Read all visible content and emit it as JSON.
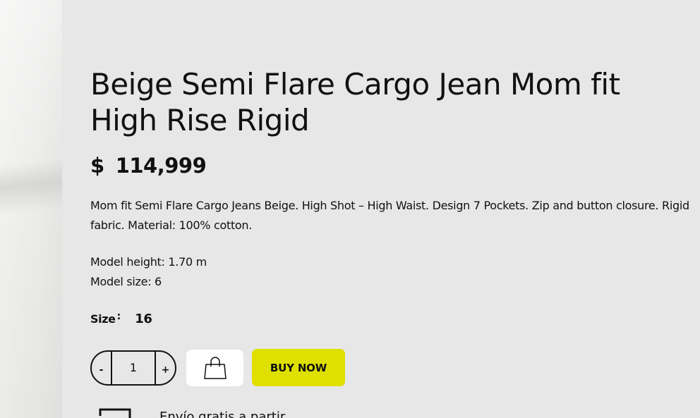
{
  "product": {
    "title": "Beige Semi Flare Cargo Jean Mom fit High Rise Rigid",
    "price": {
      "currency": "$",
      "amount": "114,999"
    },
    "description": "Mom fit Semi Flare Cargo Jeans Beige. High Shot – High Waist. Design 7 Pockets. Zip and button closure. Rigid fabric. Material: 100% cotton.",
    "model_height": "Model height: 1.70 m",
    "model_size": "Model size: 6"
  },
  "size": {
    "label": "Size",
    "colon": ":",
    "value": "16"
  },
  "quantity": {
    "decrement_label": "-",
    "increment_label": "+",
    "value": "1"
  },
  "buttons": {
    "add_to_cart_icon": "shopping-bag-icon",
    "buy_now_label": "BUY NOW"
  },
  "shipping": {
    "icon": "truck-icon",
    "text": "Envío gratis a partir"
  },
  "colors": {
    "page_background": "#e7e7e7",
    "buy_now": "#dfe000",
    "cart_button": "#ffffff",
    "text": "#111111"
  }
}
